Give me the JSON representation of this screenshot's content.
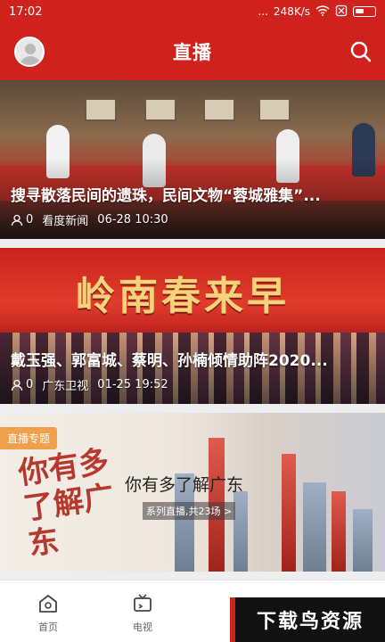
{
  "status_bar": {
    "time": "17:02",
    "dots": "...",
    "speed": "248K/s"
  },
  "header": {
    "title": "直播",
    "colors": {
      "brand": "#d0221c"
    }
  },
  "cards": [
    {
      "title": "搜寻散落民间的遗珠，民间文物“蓉城雅集”...",
      "viewers": "0",
      "source": "看度新闻",
      "time": "06-28 10:30"
    },
    {
      "title": "戴玉强、郭富城、蔡明、孙楠倾情助阵2020...",
      "viewers": "0",
      "source": "广东卫视",
      "time": "01-25 19:52",
      "banner_text": "岭南春来早"
    },
    {
      "tag": "直播专题",
      "title": "你有多了解广东",
      "subtitle": "系列直播,共23场 >",
      "calligraphy": "你有多了解广东"
    }
  ],
  "tabbar": {
    "items": [
      {
        "label": "首页",
        "icon": "home-icon"
      },
      {
        "label": "电视",
        "icon": "tv-icon"
      }
    ]
  },
  "watermark": "下载鸟资源"
}
